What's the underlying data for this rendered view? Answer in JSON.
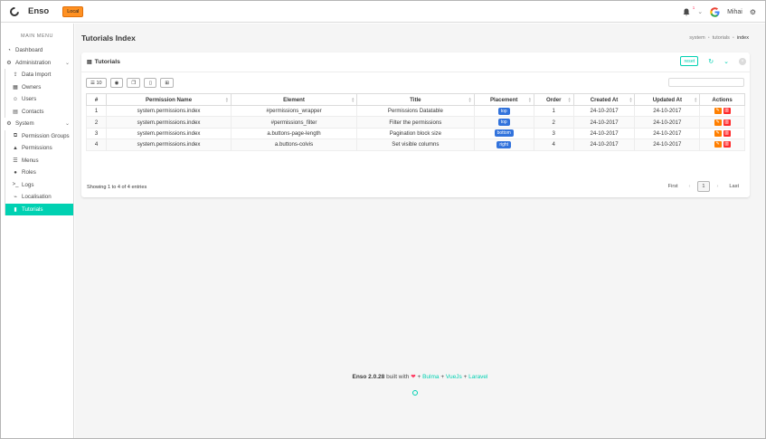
{
  "app": {
    "brand": "Enso",
    "env_badge": "Local"
  },
  "topbar": {
    "notification_count": "1",
    "user_name": "Mihai"
  },
  "sidebar": {
    "menu_label": "MAIN MENU",
    "dashboard": "Dashboard",
    "administration": "Administration",
    "admin_items": [
      "Data Import",
      "Owners",
      "Users",
      "Contacts"
    ],
    "system": "System",
    "system_items": [
      "Permission Groups",
      "Permissions",
      "Menus",
      "Roles",
      "Logs",
      "Localisation",
      "Tutorials"
    ]
  },
  "page": {
    "title": "Tutorials Index",
    "breadcrumb": [
      "system",
      "tutorials",
      "index"
    ]
  },
  "card": {
    "title": "Tutorials",
    "reset_label": "reset",
    "length_label": "10"
  },
  "table": {
    "columns": [
      "#",
      "Permission Name",
      "Element",
      "Title",
      "Placement",
      "Order",
      "Created At",
      "Updated At",
      "Actions"
    ],
    "rows": [
      {
        "n": "1",
        "permission": "system.permissions.index",
        "element": "#permissions_wrapper",
        "title": "Permissions Datatable",
        "placement": "top",
        "order": "1",
        "created": "24-10-2017",
        "updated": "24-10-2017"
      },
      {
        "n": "2",
        "permission": "system.permissions.index",
        "element": "#permissions_filter",
        "title": "Filter the permissions",
        "placement": "top",
        "order": "2",
        "created": "24-10-2017",
        "updated": "24-10-2017"
      },
      {
        "n": "3",
        "permission": "system.permissions.index",
        "element": "a.buttons-page-length",
        "title": "Pagination block size",
        "placement": "bottom",
        "order": "3",
        "created": "24-10-2017",
        "updated": "24-10-2017"
      },
      {
        "n": "4",
        "permission": "system.permissions.index",
        "element": "a.buttons-colvis",
        "title": "Set visible columns",
        "placement": "right",
        "order": "4",
        "created": "24-10-2017",
        "updated": "24-10-2017"
      }
    ],
    "showing": "Showing 1 to 4 of 4 entries"
  },
  "pagination": {
    "first": "First",
    "prev": "‹",
    "page": "1",
    "next": "›",
    "last": "Last"
  },
  "footer": {
    "version": "Enso 2.0.28",
    "built_with": "built with",
    "plus": "+",
    "bulma": "Bulma",
    "vuejs": "VueJs",
    "laravel": "Laravel"
  },
  "colors": {
    "accent": "#00d1b2",
    "tag": "#3273dc",
    "env": "#ff9122",
    "edit": "#ff7f00",
    "delete": "#ff2b2b"
  }
}
